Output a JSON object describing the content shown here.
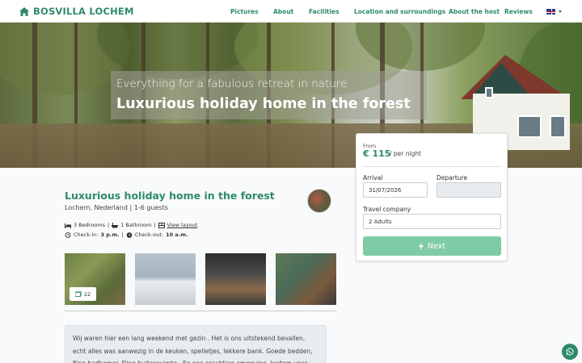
{
  "header": {
    "brand": "BOSVILLA LOCHEM",
    "nav": [
      "Pictures",
      "About",
      "Facilities",
      "Location and surroundings",
      "About the host",
      "Reviews"
    ],
    "language_icon": "uk-flag-icon"
  },
  "hero": {
    "subtitle": "Everything for a fabulous retreat in nature",
    "title": "Luxurious holiday home in the forest"
  },
  "booking": {
    "from_label": "From",
    "price": "€ 115",
    "per_night": "/ per night",
    "arrival_label": "Arrival",
    "arrival_value": "31/07/2026",
    "departure_label": "Departure",
    "departure_value": "",
    "company_label": "Travel company",
    "company_value": "2 Adults",
    "next_label": "Next"
  },
  "listing": {
    "title": "Luxurious holiday home in the forest",
    "location": "Lochem, Nederland | 1-6 guests",
    "bedrooms": "3 Bedrooms",
    "bathroom": "1 Bathroom",
    "layout_link": "View layout",
    "checkin_label": "Check-in:",
    "checkin_time": "3 p.m.",
    "checkout_label": "Check-out:",
    "checkout_time": "10 a.m.",
    "photo_count": "22",
    "review_text": "Wij waren hier een lang weekend met gezin . Het is ons uitstekend bevallen, echt alles was aanwezig in de keuken, spelletjes, lekkere bank. Goede bedden, fijne badkamer. Fijne buitenruimte . En een prachtige omgeving, kortom voor"
  },
  "colors": {
    "brand_green": "#2e8b6a",
    "next_button": "#7fcba5"
  }
}
